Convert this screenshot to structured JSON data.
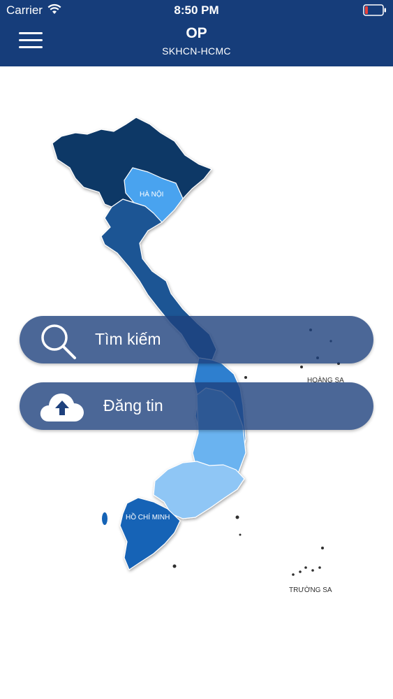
{
  "status_bar": {
    "carrier": "Carrier",
    "time": "8:50 PM"
  },
  "header": {
    "menu_icon": "hamburger-menu-icon",
    "title": "OP",
    "subtitle": "SKHCN-HCMC"
  },
  "map": {
    "labels": {
      "hanoi": "HÀ NỘI",
      "hcm": "HỒ CHÍ MINH",
      "hoang_sa": "HOÀNG SA",
      "truong_sa": "TRƯỜNG SA"
    }
  },
  "actions": {
    "search": {
      "label": "Tìm kiếm",
      "icon": "search-icon"
    },
    "post": {
      "label": "Đăng tin",
      "icon": "cloud-upload-icon"
    }
  },
  "colors": {
    "header": "#163d7a",
    "button": "#1e417d",
    "north": "#0d3766",
    "north_central": "#1a5594",
    "central": "#2f7fcf",
    "highlands": "#6bb3f0",
    "southeast": "#8fc6f5",
    "south": "#1563b6",
    "hanoi": "#4aa3ef"
  }
}
